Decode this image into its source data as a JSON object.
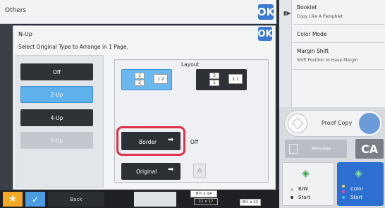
{
  "others": {
    "title": "Others",
    "ok_label": "OK"
  },
  "right_panel": {
    "items": [
      {
        "title": "Booklet",
        "subtitle": "Copy Like A Pamphlet"
      },
      {
        "title": "Color Mode",
        "subtitle": ""
      },
      {
        "title": "Margin Shift",
        "subtitle": "Shift Position to Have Margin"
      }
    ]
  },
  "nup": {
    "title": "N-Up",
    "subtitle": "Select Original Type to Arrange in 1 Page.",
    "ok_label": "OK",
    "options": [
      {
        "label": "Off",
        "state": "normal"
      },
      {
        "label": "2-Up",
        "state": "selected"
      },
      {
        "label": "4-Up",
        "state": "normal"
      },
      {
        "label": "8-Up",
        "state": "disabled"
      }
    ],
    "layout_label": "Layout",
    "layout_1": {
      "pages": [
        "1",
        "2"
      ],
      "order": "1 2"
    },
    "layout_2": {
      "pages": [
        "2",
        "1"
      ],
      "order": "2 1"
    },
    "border_label": "Border",
    "border_value": "Off",
    "original_label": "Original",
    "original_icon_glyph": "A"
  },
  "actions": {
    "proof_copy": "Proof Copy",
    "preview": "Preview",
    "ca": "CA",
    "bw": "B/W",
    "bw_start": "Start",
    "color": "Color",
    "color_start": "Start"
  },
  "taskbar": {
    "back": "Back",
    "paper_a": "8½ x 14",
    "paper_b": "11 x 17",
    "paper_c": "8½ x 11"
  },
  "colors": {
    "accent": "#3a7ad2",
    "highlight": "#e0304a",
    "selected": "#5fb1ec",
    "ca": "#7a7f87"
  }
}
